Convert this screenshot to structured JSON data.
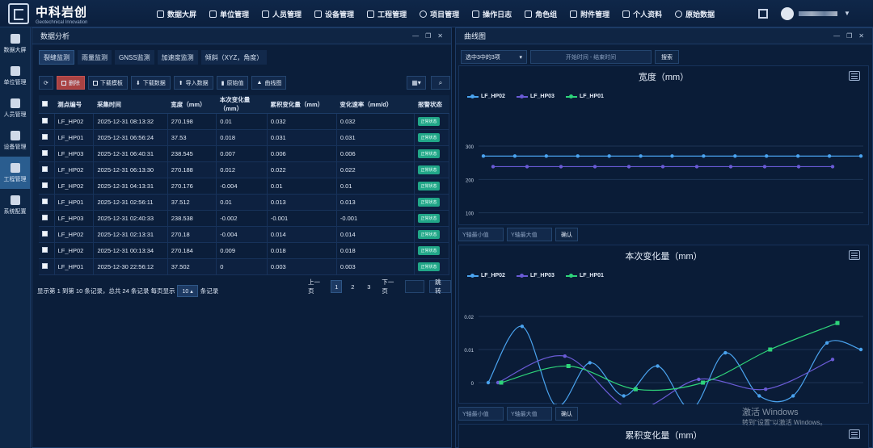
{
  "brand": {
    "name": "中科岩创",
    "subtitle": "Geotechnical Innovation"
  },
  "topnav": [
    {
      "label": "数据大屏",
      "icon": "dashboard-icon"
    },
    {
      "label": "单位管理",
      "icon": "company-icon"
    },
    {
      "label": "人员管理",
      "icon": "people-icon"
    },
    {
      "label": "设备管理",
      "icon": "gear-icon"
    },
    {
      "label": "工程管理",
      "icon": "project-icon"
    },
    {
      "label": "项目管理",
      "icon": "circle-icon"
    },
    {
      "label": "操作日志",
      "icon": "log-icon"
    },
    {
      "label": "角色组",
      "icon": "role-icon"
    },
    {
      "label": "附件管理",
      "icon": "attachment-icon"
    },
    {
      "label": "个人资料",
      "icon": "user-icon"
    },
    {
      "label": "原始数据",
      "icon": "circle-icon"
    }
  ],
  "sidebar": [
    {
      "label": "数据大屏",
      "icon": "cube-icon"
    },
    {
      "label": "单位管理",
      "icon": "calendar-icon"
    },
    {
      "label": "人员管理",
      "icon": "id-card-icon"
    },
    {
      "label": "设备管理",
      "icon": "gear-icon"
    },
    {
      "label": "工程管理",
      "icon": "image-icon"
    },
    {
      "label": "系统配置",
      "icon": "dots-icon"
    }
  ],
  "left_panel": {
    "title": "数据分析",
    "subtabs": [
      "裂缝监测",
      "雨量监测",
      "GNSS监测",
      "加速度监测",
      "倾斜（XYZ，角度）"
    ],
    "toolbar": {
      "refresh": "",
      "delete": "删除",
      "download_template": "下载模板",
      "download_data": "下载数据",
      "import_data": "导入数据",
      "raw_values": "原始值",
      "curve_chart": "曲线图"
    },
    "columns": [
      "测点编号",
      "采集时间",
      "宽度（mm）",
      "本次变化量（mm）",
      "累积变化量（mm）",
      "变化速率（mm/d）",
      "报警状态"
    ],
    "rows": [
      [
        "LF_HP02",
        "2025-12-31 08:13:32",
        "270.198",
        "0.01",
        "0.032",
        "0.032",
        "正常状态"
      ],
      [
        "LF_HP01",
        "2025-12-31 06:56:24",
        "37.53",
        "0.018",
        "0.031",
        "0.031",
        "正常状态"
      ],
      [
        "LF_HP03",
        "2025-12-31 06:40:31",
        "238.545",
        "0.007",
        "0.006",
        "0.006",
        "正常状态"
      ],
      [
        "LF_HP02",
        "2025-12-31 06:13:30",
        "270.188",
        "0.012",
        "0.022",
        "0.022",
        "正常状态"
      ],
      [
        "LF_HP02",
        "2025-12-31 04:13:31",
        "270.176",
        "-0.004",
        "0.01",
        "0.01",
        "正常状态"
      ],
      [
        "LF_HP01",
        "2025-12-31 02:56:11",
        "37.512",
        "0.01",
        "0.013",
        "0.013",
        "正常状态"
      ],
      [
        "LF_HP03",
        "2025-12-31 02:40:33",
        "238.538",
        "-0.002",
        "-0.001",
        "-0.001",
        "正常状态"
      ],
      [
        "LF_HP02",
        "2025-12-31 02:13:31",
        "270.18",
        "-0.004",
        "0.014",
        "0.014",
        "正常状态"
      ],
      [
        "LF_HP02",
        "2025-12-31 00:13:34",
        "270.184",
        "0.009",
        "0.018",
        "0.018",
        "正常状态"
      ],
      [
        "LF_HP01",
        "2025-12-30 22:56:12",
        "37.502",
        "0",
        "0.003",
        "0.003",
        "正常状态"
      ]
    ],
    "pager": {
      "info_prefix": "显示第 1 到第 10 条记录，总共 24 条记录 每页显示",
      "page_size": "10",
      "info_suffix": "条记录",
      "prev": "上一页",
      "pages": [
        "1",
        "2",
        "3"
      ],
      "next": "下一页",
      "jump": "跳转"
    }
  },
  "right_panel": {
    "title": "曲线图",
    "series_select": "选中3中的3项",
    "time_placeholder": "开始时间 - 结束时间",
    "search": "搜索",
    "y_min_placeholder": "Y轴最小值",
    "y_max_placeholder": "Y轴最大值",
    "confirm": "确认"
  },
  "watermark": {
    "line1": "激活 Windows",
    "line2": "转到\"设置\"以激活 Windows。"
  },
  "colors": {
    "HP02": "#4aa3ef",
    "HP03": "#6a5bd6",
    "HP01": "#2ed47a"
  },
  "chart_data": [
    {
      "type": "line",
      "title": "宽度（mm）",
      "x": [
        "12-30",
        "12-30",
        "12-30",
        "12-30",
        "12-31",
        "12-31",
        "12-31"
      ],
      "ylim": [
        0,
        300
      ],
      "yticks": [
        0,
        100,
        200,
        300
      ],
      "series": [
        {
          "name": "LF_HP02",
          "values": [
            270.1,
            270.1,
            270.1,
            270.1,
            270.1,
            270.1,
            270.1,
            270.1,
            270.1,
            270.1,
            270.1,
            270.1,
            270.2
          ]
        },
        {
          "name": "LF_HP03",
          "values": [
            238.5,
            238.5,
            238.5,
            238.5,
            238.5,
            238.5,
            238.5,
            238.5,
            238.5,
            238.5,
            238.5
          ]
        },
        {
          "name": "LF_HP01",
          "values": [
            37.5,
            37.5,
            37.5,
            37.5,
            37.5,
            37.5,
            37.5,
            37.5,
            37.5,
            37.5,
            37.5,
            37.5
          ]
        }
      ]
    },
    {
      "type": "line",
      "title": "本次变化量（mm）",
      "x": [
        "12-30",
        "12-30",
        "12-30",
        "12-30",
        "12-31",
        "12-31",
        "12-31"
      ],
      "ylim": [
        -0.01,
        0.02
      ],
      "yticks": [
        -0.01,
        0,
        0.01,
        0.02
      ],
      "series": [
        {
          "name": "LF_HP02",
          "values": [
            0,
            0.017,
            -0.007,
            0.006,
            -0.004,
            0.005,
            -0.008,
            0.009,
            -0.004,
            -0.004,
            0.012,
            0.01
          ]
        },
        {
          "name": "LF_HP03",
          "values": [
            0,
            0.008,
            -0.008,
            0.001,
            -0.002,
            0.007
          ]
        },
        {
          "name": "LF_HP01",
          "values": [
            0,
            0.005,
            -0.002,
            0,
            0.01,
            0.018
          ]
        }
      ]
    },
    {
      "type": "line",
      "title": "累积变化量（mm）"
    }
  ]
}
